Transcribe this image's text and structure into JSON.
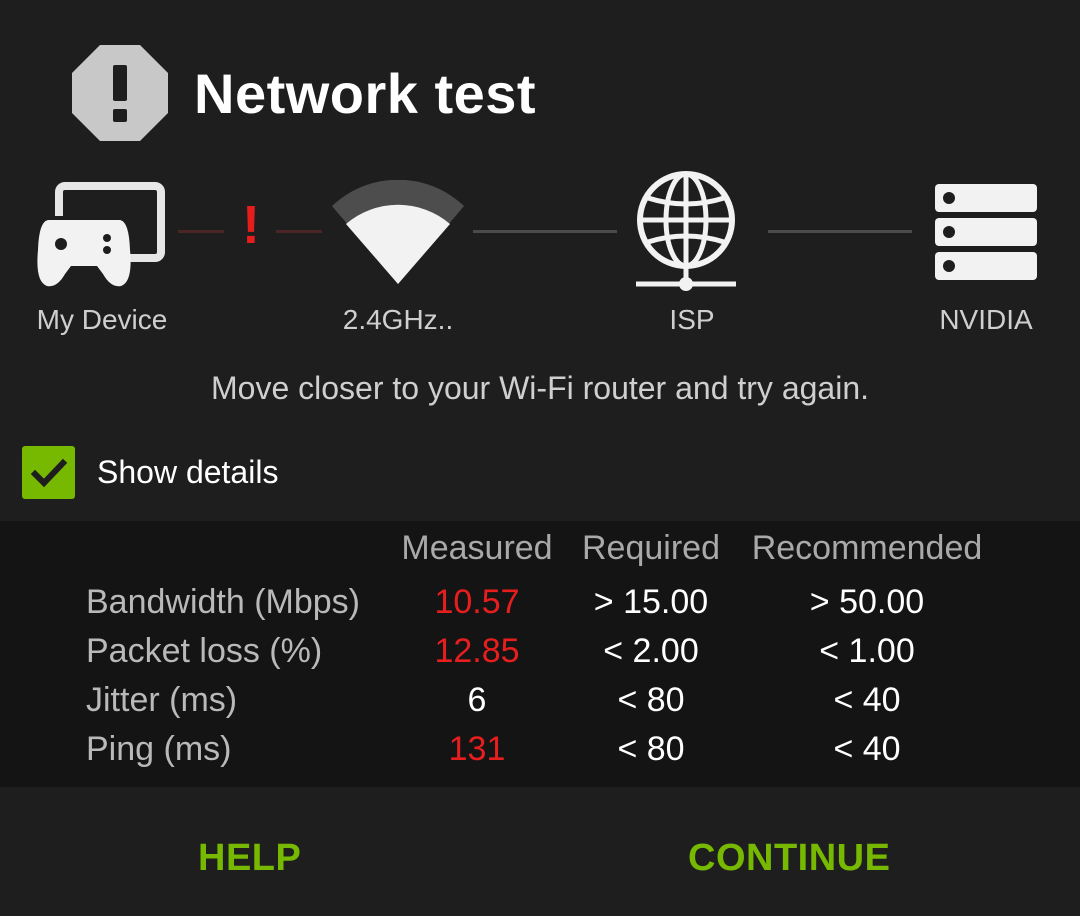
{
  "dialog": {
    "title": "Network test",
    "icon": "warning-octagon-icon"
  },
  "path": {
    "nodes": [
      {
        "label": "My Device",
        "icon": "gamepad-cast-icon"
      },
      {
        "label": "2.4GHz..",
        "icon": "wifi-signal-icon"
      },
      {
        "label": "ISP",
        "icon": "globe-network-icon"
      },
      {
        "label": "NVIDIA",
        "icon": "server-stack-icon"
      }
    ],
    "alert_symbol": "!"
  },
  "message": "Move closer to your Wi-Fi router and try again.",
  "details": {
    "checked": true,
    "label": "Show details"
  },
  "table": {
    "headers": {
      "measured": "Measured",
      "required": "Required",
      "recommended": "Recommended"
    },
    "rows": [
      {
        "label": "Bandwidth (Mbps)",
        "measured": "10.57",
        "required": "> 15.00",
        "recommended": "> 50.00",
        "status": "bad"
      },
      {
        "label": "Packet loss (%)",
        "measured": "12.85",
        "required": "< 2.00",
        "recommended": "< 1.00",
        "status": "bad"
      },
      {
        "label": "Jitter (ms)",
        "measured": "6",
        "required": "< 80",
        "recommended": "< 40",
        "status": "ok"
      },
      {
        "label": "Ping (ms)",
        "measured": "131",
        "required": "< 80",
        "recommended": "< 40",
        "status": "bad"
      }
    ]
  },
  "buttons": {
    "help": "HELP",
    "continue": "CONTINUE"
  },
  "colors": {
    "accent": "#76b900",
    "error": "#e81e1e",
    "background": "#1e1e1e",
    "table_background": "#141414"
  }
}
